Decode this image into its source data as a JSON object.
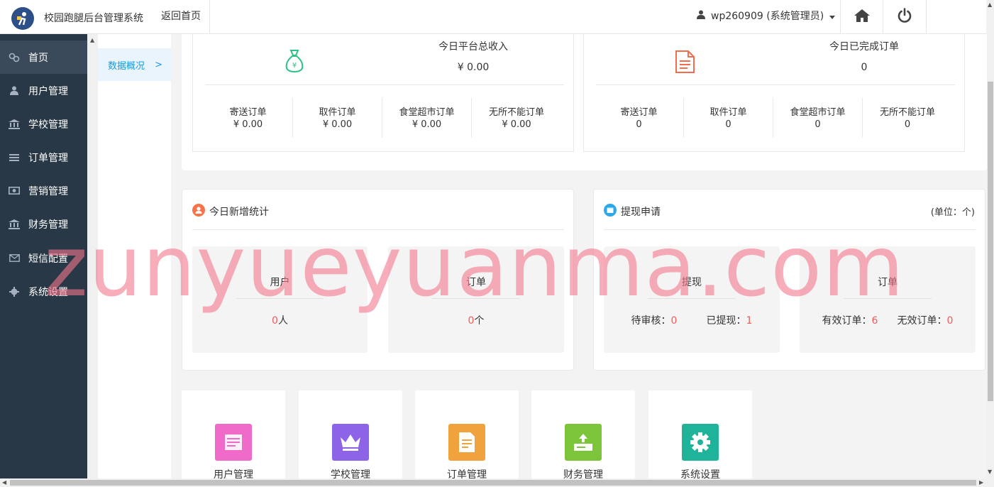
{
  "header": {
    "app_title": "校园跑腿后台管理系统",
    "back_home": "返回首页",
    "user": "wp260909 (系统管理员)"
  },
  "sidebar": {
    "items": [
      {
        "label": "首页",
        "icon": "dashboard-icon",
        "active": true
      },
      {
        "label": "用户管理",
        "icon": "user-icon"
      },
      {
        "label": "学校管理",
        "icon": "bank-icon"
      },
      {
        "label": "订单管理",
        "icon": "list-icon"
      },
      {
        "label": "营销管理",
        "icon": "money-icon"
      },
      {
        "label": "财务管理",
        "icon": "bank-icon"
      },
      {
        "label": "短信配置",
        "icon": "envelope-icon"
      },
      {
        "label": "系统设置",
        "icon": "gear-icon"
      }
    ]
  },
  "subnav": {
    "item": "数据概况",
    "arrow": ">"
  },
  "income": {
    "title": "今日平台总收入",
    "value": "¥ 0.00",
    "cols": [
      {
        "label": "寄送订单",
        "value": "¥ 0.00"
      },
      {
        "label": "取件订单",
        "value": "¥ 0.00"
      },
      {
        "label": "食堂超市订单",
        "value": "¥ 0.00"
      },
      {
        "label": "无所不能订单",
        "value": "¥ 0.00"
      }
    ]
  },
  "completed": {
    "title": "今日已完成订单",
    "value": "0",
    "cols": [
      {
        "label": "寄送订单",
        "value": "0"
      },
      {
        "label": "取件订单",
        "value": "0"
      },
      {
        "label": "食堂超市订单",
        "value": "0"
      },
      {
        "label": "无所不能订单",
        "value": "0"
      }
    ]
  },
  "new_stats": {
    "title": "今日新增统计",
    "user_label": "用户",
    "user_value": "0",
    "user_unit": "人",
    "order_label": "订单",
    "order_value": "0",
    "order_unit": "个"
  },
  "withdraw": {
    "title": "提现申请",
    "unit_note": "(单位：个)",
    "box1_label": "提现",
    "pending_label": "待审核：",
    "pending_value": "0",
    "done_label": "已提现：",
    "done_value": "1",
    "box2_label": "订单",
    "valid_label": "有效订单：",
    "valid_value": "6",
    "invalid_label": "无效订单：",
    "invalid_value": "0"
  },
  "quick_links": [
    {
      "label": "用户管理",
      "color": "#f06ac9",
      "icon": "user-manage-icon"
    },
    {
      "label": "学校管理",
      "color": "#8d63e8",
      "icon": "crown-icon"
    },
    {
      "label": "订单管理",
      "color": "#f0a33c",
      "icon": "document-icon"
    },
    {
      "label": "财务管理",
      "color": "#7cc43a",
      "icon": "finance-icon"
    },
    {
      "label": "系统设置",
      "color": "#1fb49a",
      "icon": "gear-icon"
    }
  ],
  "watermark": "zunyueyuanma.com"
}
